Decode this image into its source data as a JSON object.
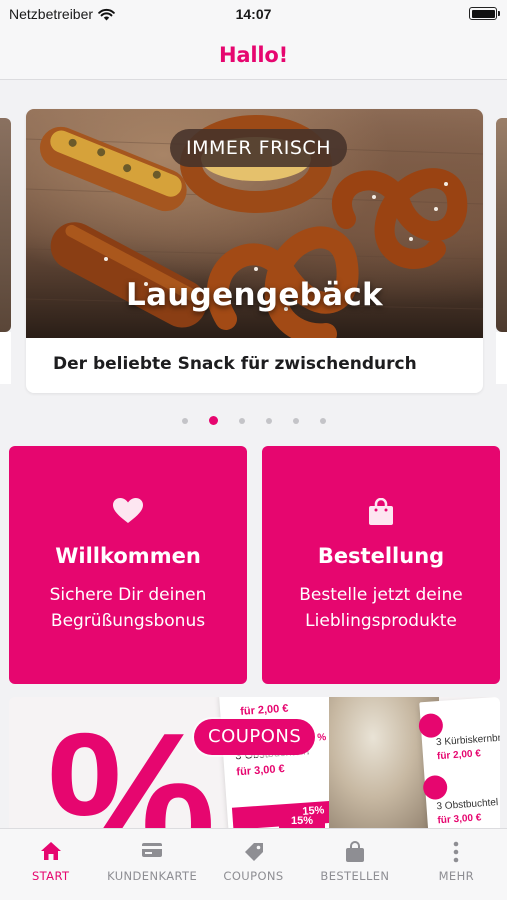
{
  "status_bar": {
    "carrier": "Netzbetreiber",
    "time": "14:07"
  },
  "header": {
    "title": "Hallo!"
  },
  "carousel": {
    "badge": "IMMER FRISCH",
    "title": "Laugengebäck",
    "caption": "Der beliebte Snack für zwischendurch",
    "page_count": 6,
    "active_index": 1
  },
  "tiles": [
    {
      "icon": "heart-icon",
      "title": "Willkommen",
      "line1": "Sichere Dir deinen",
      "line2": "Begrüßungsbonus"
    },
    {
      "icon": "shopping-bag-icon",
      "title": "Bestellung",
      "line1": "Bestelle jetzt deine",
      "line2": "Lieblingsprodukte"
    }
  ],
  "coupon_banner": {
    "badge": "COUPONS",
    "percent_glyph": "%",
    "coupon_texts": {
      "a": "für 2,00 €",
      "b": "3 Obstbuchteln",
      "c": "für 3,00 €",
      "d": "3 Kürbiskernbr",
      "e": "für 2,00 €",
      "f": "3 Obstbuchtel",
      "g": "für 3,00 €",
      "h": "15%",
      "i": "15%",
      "j": "%"
    }
  },
  "tab_bar": {
    "items": [
      {
        "label": "START",
        "icon": "home-icon",
        "active": true
      },
      {
        "label": "KUNDENKARTE",
        "icon": "card-icon",
        "active": false
      },
      {
        "label": "COUPONS",
        "icon": "tag-icon",
        "active": false
      },
      {
        "label": "BESTELLEN",
        "icon": "shopping-bag-icon",
        "active": false
      },
      {
        "label": "MEHR",
        "icon": "more-icon",
        "active": false
      }
    ]
  },
  "colors": {
    "brand": "#e6066f",
    "background": "#f2f2f4",
    "tab_inactive": "#8e8e93"
  }
}
